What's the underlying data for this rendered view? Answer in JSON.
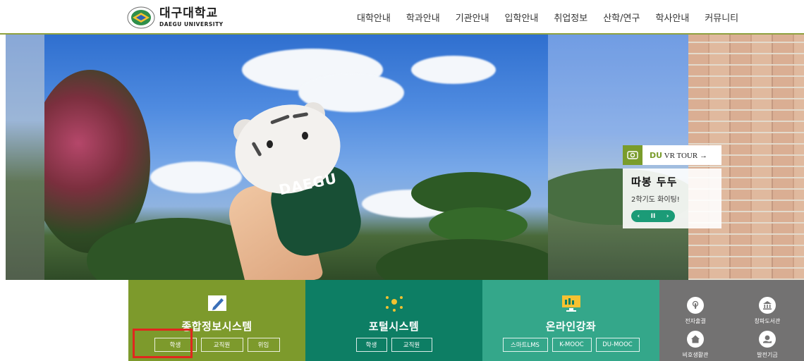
{
  "header": {
    "logo": {
      "name_kr": "대구대학교",
      "name_en": "DAEGU UNIVERSITY"
    },
    "nav": [
      "대학안내",
      "학과안내",
      "기관안내",
      "입학안내",
      "취업정보",
      "산학/연구",
      "학사안내",
      "커뮤니티"
    ]
  },
  "hero": {
    "shirt_text": "DAEGU",
    "vr_tour": {
      "brand": "DU",
      "label": "VR TOUR →",
      "icon": "vr-camera-icon"
    },
    "caption": {
      "title": "따봉 두두",
      "subtitle": "2학기도 화이팅!"
    },
    "controls": {
      "prev": "‹",
      "pause": "II",
      "next": "›"
    }
  },
  "quick_menu": {
    "general": {
      "title": "종합정보시스템",
      "icon": "pencil-icon",
      "buttons": [
        "학생",
        "교직원",
        "위임"
      ],
      "color": "#7d9a2c"
    },
    "portal": {
      "title": "포털시스템",
      "icon": "network-icon",
      "buttons": [
        "학생",
        "교직원"
      ],
      "color": "#0d7e64"
    },
    "online": {
      "title": "온라인강좌",
      "icon": "monitor-icon",
      "buttons": [
        "스마트LMS",
        "K-MOOC",
        "DU-MOOC"
      ],
      "color": "#34a78a"
    },
    "links": [
      {
        "label": "전자출결",
        "icon": "touch-icon"
      },
      {
        "label": "창파도서관",
        "icon": "library-icon"
      },
      {
        "label": "비호생활관",
        "icon": "home-icon"
      },
      {
        "label": "발전기금",
        "icon": "donation-icon"
      }
    ]
  },
  "colors": {
    "accent": "#8fa13f",
    "highlight": "#e0271e"
  }
}
